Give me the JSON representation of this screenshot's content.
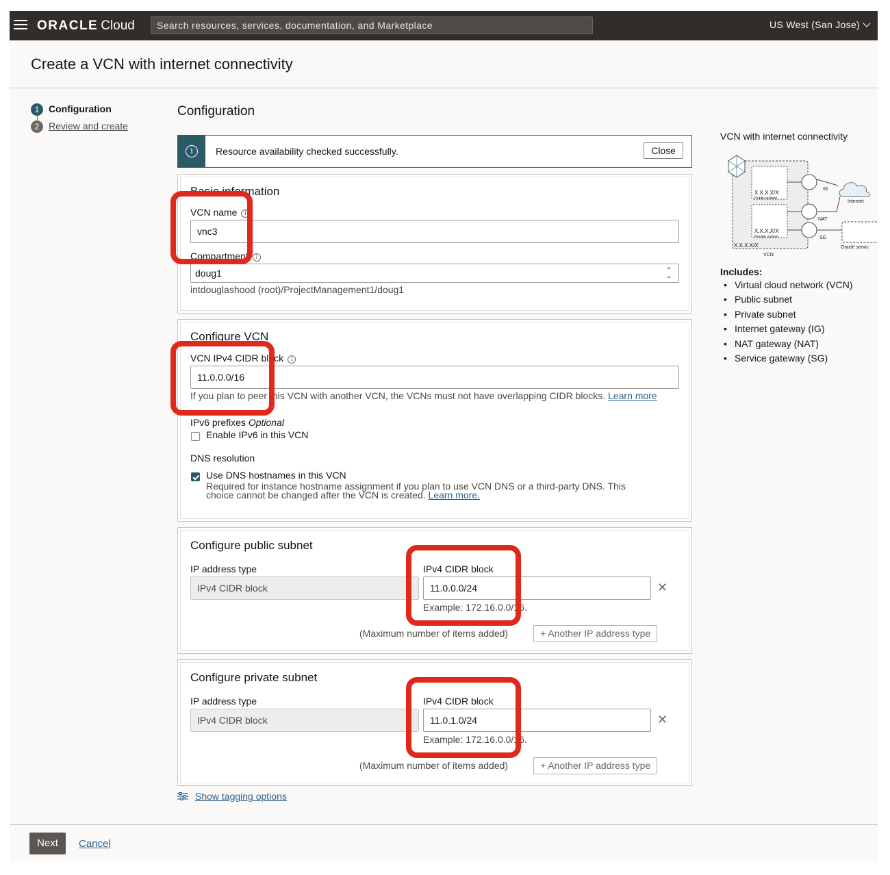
{
  "header": {
    "logo_brand": "ORACLE",
    "logo_product": "Cloud",
    "search_placeholder": "Search resources, services, documentation, and Marketplace",
    "region": "US West (San Jose)"
  },
  "page_title": "Create a VCN with internet connectivity",
  "steps": [
    {
      "number": "1",
      "label": "Configuration"
    },
    {
      "number": "2",
      "label": "Review and create"
    }
  ],
  "section_title": "Configuration",
  "alert": {
    "message": "Resource availability checked successfully.",
    "close_label": "Close"
  },
  "basic": {
    "title": "Basic information",
    "vcn_name_label": "VCN name",
    "vcn_name_value": "vnc3",
    "compartment_label": "Compartment",
    "compartment_value": "doug1",
    "compartment_path": "intdouglashood (root)/ProjectManagement1/doug1"
  },
  "vcn": {
    "title": "Configure VCN",
    "cidr_label": "VCN IPv4 CIDR block",
    "cidr_value": "11.0.0.0/16",
    "cidr_hint": "If you plan to peer this VCN with another VCN, the VCNs must not have overlapping CIDR blocks.",
    "cidr_hint_link": "Learn more",
    "ipv6_label": "IPv6 prefixes",
    "ipv6_optional": "Optional",
    "ipv6_checkbox": "Enable IPv6 in this VCN",
    "dns_label": "DNS resolution",
    "dns_checkbox": "Use DNS hostnames in this VCN",
    "dns_hint_1": "Required for instance hostname assignment if you plan to use VCN DNS or a third-party DNS. This",
    "dns_hint_2": "choice cannot be changed after the VCN is created.",
    "dns_hint_link": "Learn more."
  },
  "public_subnet": {
    "title": "Configure public subnet",
    "ip_type_label": "IP address type",
    "ip_type_value": "IPv4 CIDR block",
    "cidr_label": "IPv4 CIDR block",
    "cidr_value": "11.0.0.0/24",
    "example": "Example: 172.16.0.0/16.",
    "max_items": "(Maximum number of items added)",
    "add_button": "+ Another IP address type"
  },
  "private_subnet": {
    "title": "Configure private subnet",
    "ip_type_label": "IP address type",
    "ip_type_value": "IPv4 CIDR block",
    "cidr_label": "IPv4 CIDR block",
    "cidr_value": "11.0.1.0/24",
    "example": "Example: 172.16.0.0/16.",
    "max_items": "(Maximum number of items added)",
    "add_button": "+ Another IP address type"
  },
  "tagging_link": "Show tagging options",
  "diagram": {
    "title": "VCN with internet connectivity",
    "labels": {
      "cidr_public": "X.X.X.X/X",
      "public_subnet": "Public subnet",
      "cidr_private": "X.X.X.X/X",
      "private_subnet": "Private subnet",
      "vcn_cidr": "X.X.X.X/X",
      "vcn": "VCN",
      "ig": "IG",
      "nat": "NAT",
      "sg": "SG",
      "internet": "Internet",
      "oracle_services": "Oracle servic"
    }
  },
  "includes": {
    "title": "Includes:",
    "items": [
      "Virtual cloud network (VCN)",
      "Public subnet",
      "Private subnet",
      "Internet gateway (IG)",
      "NAT gateway (NAT)",
      "Service gateway (SG)"
    ]
  },
  "footer": {
    "next_label": "Next",
    "cancel_label": "Cancel"
  },
  "colors": {
    "highlight": "#e0281c",
    "header_bg": "#312d2a",
    "accent": "#2c5967",
    "link": "#2c5f8a"
  }
}
